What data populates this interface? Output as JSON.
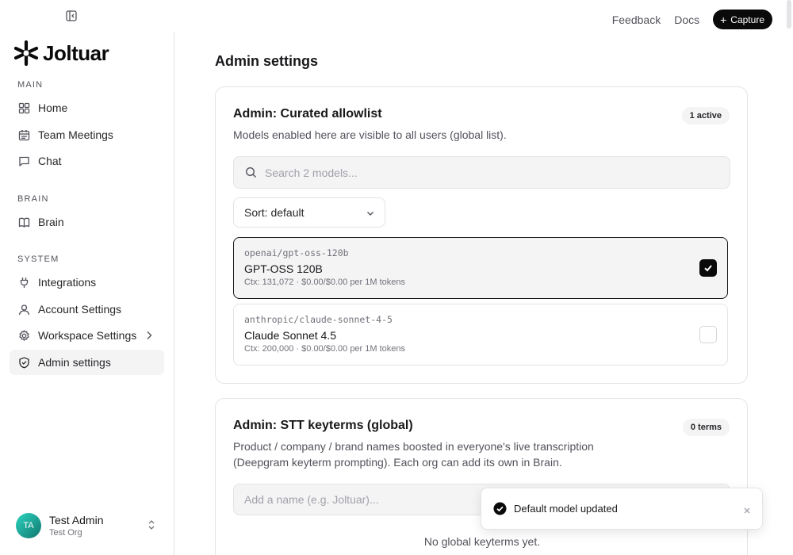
{
  "header": {
    "links": [
      "Feedback",
      "Docs"
    ],
    "capture_label": "Capture"
  },
  "brand": {
    "name": "Joltuar"
  },
  "sidebar": {
    "sections": [
      {
        "label": "MAIN",
        "items": [
          {
            "label": "Home",
            "icon": "grid-icon"
          },
          {
            "label": "Team Meetings",
            "icon": "calendar-icon"
          },
          {
            "label": "Chat",
            "icon": "chat-icon"
          }
        ]
      },
      {
        "label": "BRAIN",
        "items": [
          {
            "label": "Brain",
            "icon": "book-icon"
          }
        ]
      },
      {
        "label": "SYSTEM",
        "items": [
          {
            "label": "Integrations",
            "icon": "plug-icon"
          },
          {
            "label": "Account Settings",
            "icon": "user-icon"
          },
          {
            "label": "Workspace Settings",
            "icon": "gear-icon"
          },
          {
            "label": "Admin settings",
            "icon": "shield-icon",
            "active": true
          }
        ]
      }
    ],
    "user": {
      "initials": "TA",
      "name": "Test Admin",
      "org": "Test Org"
    }
  },
  "main": {
    "title": "Admin settings",
    "allowlist": {
      "title": "Admin: Curated allowlist",
      "badge": "1 active",
      "description": "Models enabled here are visible to all users (global list).",
      "search_placeholder": "Search 2 models...",
      "sort_label": "Sort: default",
      "models": [
        {
          "id": "openai/gpt-oss-120b",
          "name": "GPT-OSS 120B",
          "meta": "Ctx: 131,072 · $0.00/$0.00 per 1M tokens",
          "checked": true
        },
        {
          "id": "anthropic/claude-sonnet-4-5",
          "name": "Claude Sonnet 4.5",
          "meta": "Ctx: 200,000 · $0.00/$0.00 per 1M tokens",
          "checked": false
        }
      ]
    },
    "keyterms": {
      "title": "Admin: STT keyterms (global)",
      "badge": "0 terms",
      "description_line1": "Product / company / brand names boosted in everyone's live transcription",
      "description_line2": "(Deepgram keyterm prompting). Each org can add its own in Brain.",
      "input_placeholder": "Add a name (e.g. Joltuar)...",
      "empty_text": "No global keyterms yet."
    }
  },
  "toast": {
    "message": "Default model updated"
  },
  "colors": {
    "primary": "#0a0a0a",
    "muted": "#f4f4f5",
    "border": "#e4e4e7",
    "avatar": "#14b8a6"
  }
}
